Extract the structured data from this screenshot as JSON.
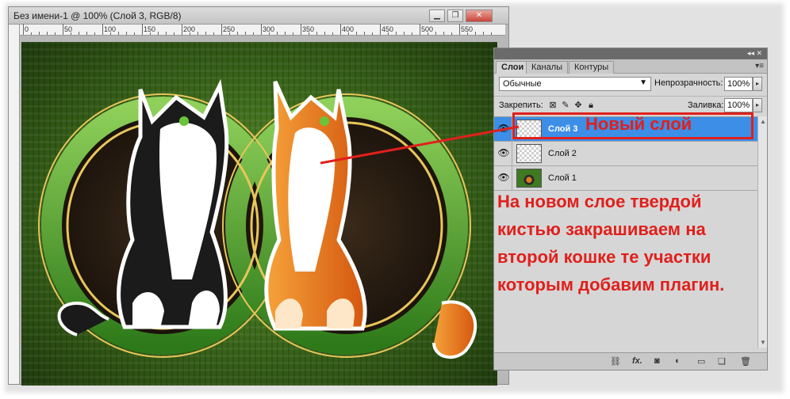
{
  "document": {
    "title": "Без имени-1 @ 100% (Слой 3, RGB/8)",
    "window_buttons": [
      "minimize-icon",
      "restore-icon",
      "close-icon"
    ],
    "ruler_labels": [
      "0",
      "50",
      "100",
      "150",
      "200",
      "250",
      "300",
      "350",
      "400",
      "450",
      "500",
      "550"
    ]
  },
  "layers_panel": {
    "tabs": [
      "Слои",
      "Каналы",
      "Контуры"
    ],
    "active_tab": "Слои",
    "blend_mode": "Обычные",
    "opacity_label": "Непрозрачность:",
    "opacity_value": "100%",
    "lock_label": "Закрепить:",
    "fill_label": "Заливка:",
    "fill_value": "100%",
    "layers": [
      {
        "name": "Слой 3",
        "selected": true,
        "thumb": "transparent"
      },
      {
        "name": "Слой 2",
        "selected": false,
        "thumb": "transparent"
      },
      {
        "name": "Слой 1",
        "selected": false,
        "thumb": "image"
      }
    ],
    "bottom_icons": [
      "link-icon",
      "fx-icon",
      "mask-icon",
      "adjustment-icon",
      "folder-icon",
      "new-layer-icon",
      "trash-icon"
    ],
    "bottom_fx_label": "fx."
  },
  "annotations": {
    "callout_title": "Новый слой",
    "note_lines": [
      "На новом слое твердой",
      "кистью закрашиваем на",
      "второй кошке те участки",
      "которым добавим плагин."
    ],
    "accent_color": "#e0201c"
  }
}
